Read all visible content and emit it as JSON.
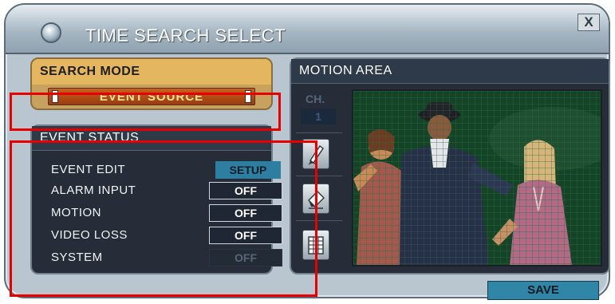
{
  "window": {
    "title": "TIME SEARCH SELECT",
    "close_label": "X"
  },
  "search_mode": {
    "title": "SEARCH MODE",
    "value": "EVENT SOURCE"
  },
  "event_status": {
    "title": "EVENT STATUS",
    "rows": [
      {
        "label": "EVENT EDIT",
        "value": "SETUP"
      },
      {
        "label": "ALARM INPUT",
        "value": "OFF"
      },
      {
        "label": "MOTION",
        "value": "OFF"
      },
      {
        "label": "VIDEO LOSS",
        "value": "OFF"
      },
      {
        "label": "SYSTEM",
        "value": "OFF"
      }
    ]
  },
  "motion_area": {
    "title": "MOTION AREA",
    "channel_label": "CH.",
    "channel_value": "1",
    "tools": [
      "pencil-icon",
      "eraser-icon",
      "grid-icon"
    ]
  },
  "footer": {
    "save_label": "SAVE"
  },
  "colors": {
    "accent": "#2f86a6",
    "search_mode_header": "#e4b65f",
    "event_source_field": "#b84a14",
    "annotation_box": "#e60000"
  }
}
